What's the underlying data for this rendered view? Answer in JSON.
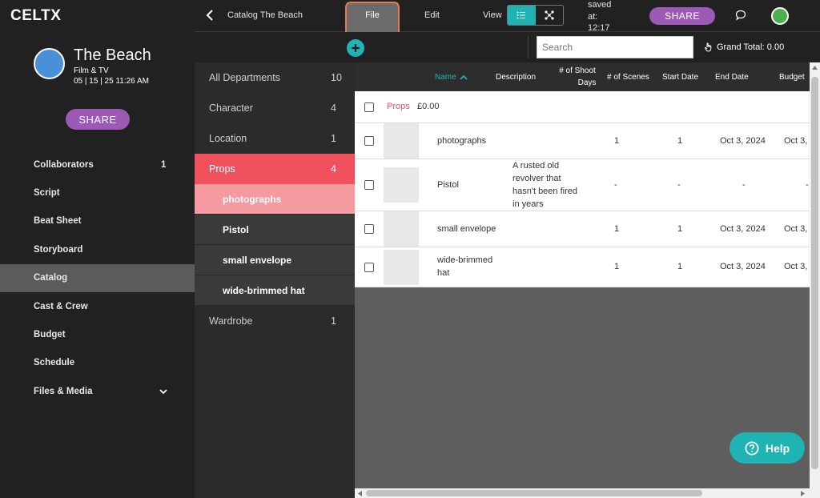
{
  "app": {
    "logo": "CELTX"
  },
  "project": {
    "title": "The Beach",
    "type": "Film & TV",
    "date": "05 | 15 | 25 11:26 AM",
    "share_label": "SHARE"
  },
  "nav": [
    {
      "label": "Collaborators",
      "count": "1"
    },
    {
      "label": "Script"
    },
    {
      "label": "Beat Sheet"
    },
    {
      "label": "Storyboard"
    },
    {
      "label": "Catalog",
      "active": true
    },
    {
      "label": "Cast & Crew"
    },
    {
      "label": "Budget"
    },
    {
      "label": "Schedule"
    },
    {
      "label": "Files & Media",
      "icon": "chevron-down-icon"
    }
  ],
  "topbar": {
    "breadcrumb": "Catalog The Beach",
    "file_label": "File",
    "edit_label": "Edit",
    "view_label": "View",
    "saved_line1": "saved",
    "saved_line2": "at:",
    "saved_line3": "12:17",
    "share_label": "SHARE"
  },
  "toolbar": {
    "search_placeholder": "Search",
    "grand_total": "Grand Total: 0.00"
  },
  "departments": [
    {
      "label": "All Departments",
      "count": "10"
    },
    {
      "label": "Character",
      "count": "4"
    },
    {
      "label": "Location",
      "count": "1"
    },
    {
      "label": "Props",
      "count": "4"
    },
    {
      "label": "Wardrobe",
      "count": "1"
    }
  ],
  "props_items": [
    "photographs",
    "Pistol",
    "small envelope",
    "wide-brimmed hat"
  ],
  "table": {
    "headers": {
      "name": "Name",
      "description": "Description",
      "shoot_days_1": "# of Shoot",
      "shoot_days_2": "Days",
      "scenes": "# of Scenes",
      "start": "Start Date",
      "end": "End Date",
      "budget": "Budget"
    },
    "group": {
      "name": "Props",
      "total": "£0.00"
    },
    "rows": [
      {
        "name": "photographs",
        "description": "",
        "shoot_days": "1",
        "scenes": "1",
        "start": "Oct 3, 2024",
        "end": "Oct 3,"
      },
      {
        "name": "Pistol",
        "desc1": "A rusted old",
        "desc2": "revolver that",
        "desc3": "hasn't been fired",
        "desc4": "in years",
        "shoot_days": "-",
        "scenes": "-",
        "start": "-",
        "end": "-"
      },
      {
        "name": "small envelope",
        "description": "",
        "shoot_days": "1",
        "scenes": "1",
        "start": "Oct 3, 2024",
        "end": "Oct 3,"
      },
      {
        "name1": "wide-brimmed",
        "name2": "hat",
        "description": "",
        "shoot_days": "1",
        "scenes": "1",
        "start": "Oct 3, 2024",
        "end": "Oct 3,"
      }
    ]
  },
  "help_label": "Help",
  "colors": {
    "accent": "#1fb3b3",
    "share": "#9c59b6",
    "props": "#f0515d",
    "highlight": "#e8784e"
  }
}
